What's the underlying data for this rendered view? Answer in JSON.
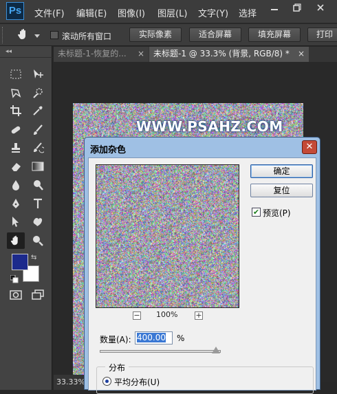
{
  "app": {
    "logo": "Ps",
    "menu": [
      "文件(F)",
      "编辑(E)",
      "图像(I)",
      "图层(L)",
      "文字(Y)",
      "选择"
    ],
    "window_controls": [
      "minimize-icon",
      "restore-icon",
      "close-icon"
    ]
  },
  "options_bar": {
    "scroll_all_windows": "滚动所有窗口",
    "actual_pixels": "实际像素",
    "fit_screen": "适合屏幕",
    "fill_screen": "填充屏幕",
    "print_size": "打印"
  },
  "tabs": [
    {
      "label": "未标题-1-恢复的...",
      "close": "×",
      "active": false
    },
    {
      "label": "未标题-1 @ 33.3% (背景, RGB/8) *",
      "close": "×",
      "active": true
    }
  ],
  "toolbox": {
    "foreground_color": "#1c2a8c",
    "background_color": "#ffffff"
  },
  "canvas": {
    "watermark": "WWW.PSAHZ.COM"
  },
  "status": {
    "zoom": "33.33%"
  },
  "dialog": {
    "title": "添加杂色",
    "close": "✕",
    "ok_label": "确定",
    "reset_label": "复位",
    "preview_label": "预览(P)",
    "preview_checked": true,
    "zoom_out": "−",
    "zoom_in": "+",
    "zoom_level": "100%",
    "amount_label": "数量(A):",
    "amount_value": "400.00",
    "amount_unit": "%",
    "slider_fraction": 0.96,
    "distribution_label": "分布",
    "uniform_label": "平均分布(U)"
  }
}
